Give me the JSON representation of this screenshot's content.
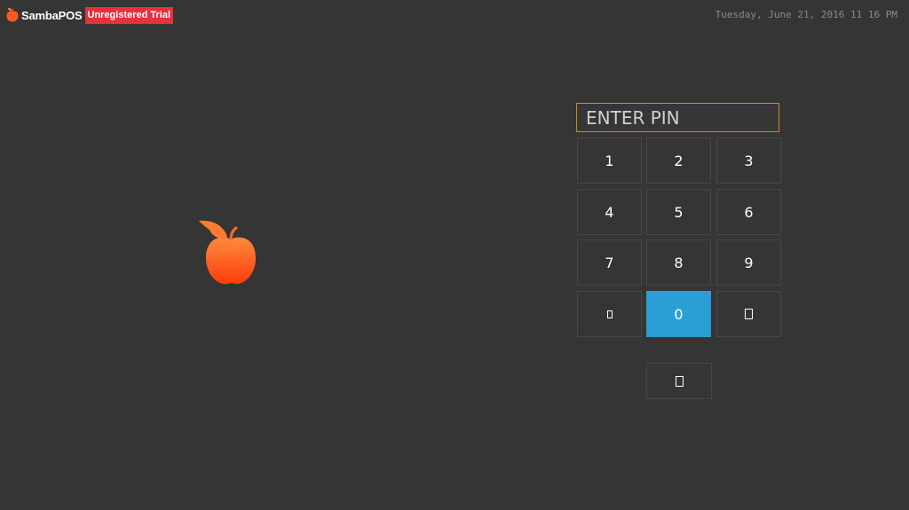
{
  "header": {
    "brand": "SambaPOS",
    "badge": "Unregistered Trial",
    "datetime": "Tuesday, June 21, 2016 11 16 PM"
  },
  "login": {
    "pin_placeholder": "ENTER PIN",
    "keys": {
      "k1": "1",
      "k2": "2",
      "k3": "3",
      "k4": "4",
      "k5": "5",
      "k6": "6",
      "k7": "7",
      "k8": "8",
      "k9": "9",
      "k0": "0"
    },
    "icons": {
      "left_key": "clear-icon",
      "right_key": "enter-icon",
      "bottom_key": "shutdown-icon"
    }
  },
  "colors": {
    "background": "#353535",
    "accent": "#2a9fd6",
    "input_border": "#d2891e",
    "badge": "#e8303a",
    "logo": "#ff5a1f"
  }
}
